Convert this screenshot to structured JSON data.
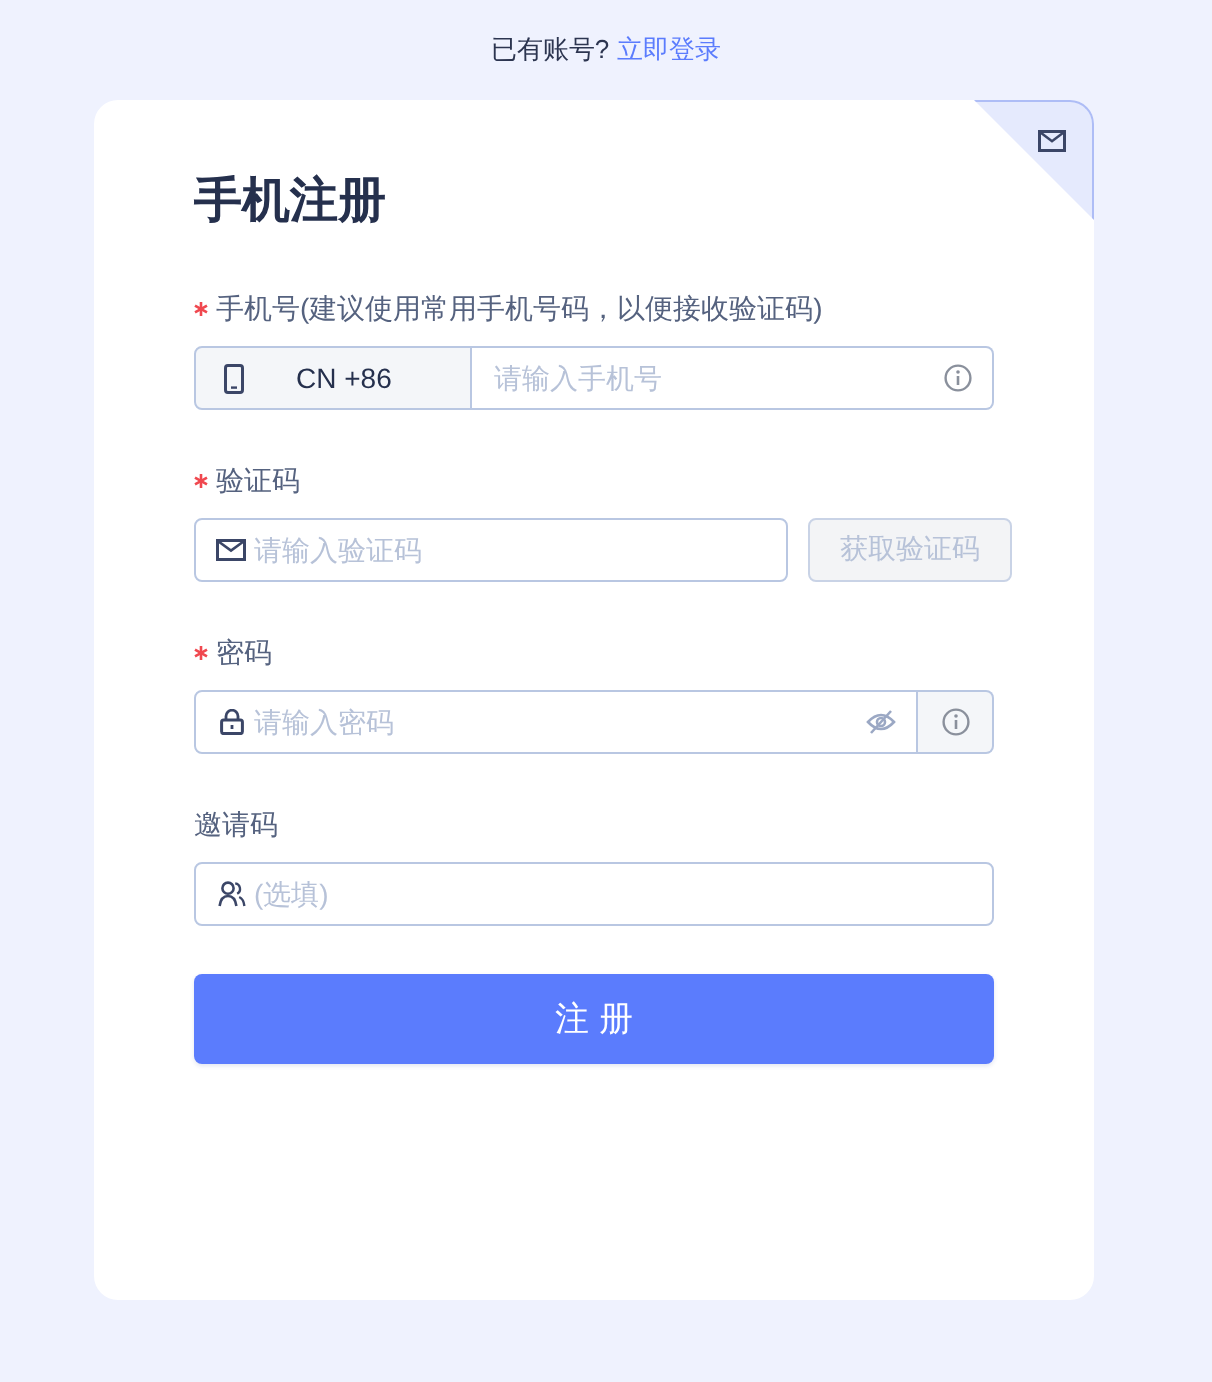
{
  "top_bar": {
    "text": "已有账号?",
    "link": "立即登录"
  },
  "card": {
    "title": "手机注册"
  },
  "fields": [
    {
      "kind": "phone",
      "label": "手机号(建议使用常用手机号码，以便接收验证码)",
      "required": true,
      "country": "CN +86",
      "placeholder": "请输入手机号"
    },
    {
      "kind": "code",
      "label": "验证码",
      "required": true,
      "placeholder": "请输入验证码",
      "button": "获取验证码",
      "button_disabled": true
    },
    {
      "kind": "password",
      "label": "密码",
      "required": true,
      "placeholder": "请输入密码"
    },
    {
      "kind": "invite",
      "label": "邀请码",
      "required": false,
      "placeholder": "(选填)"
    }
  ],
  "submit": "注 册"
}
